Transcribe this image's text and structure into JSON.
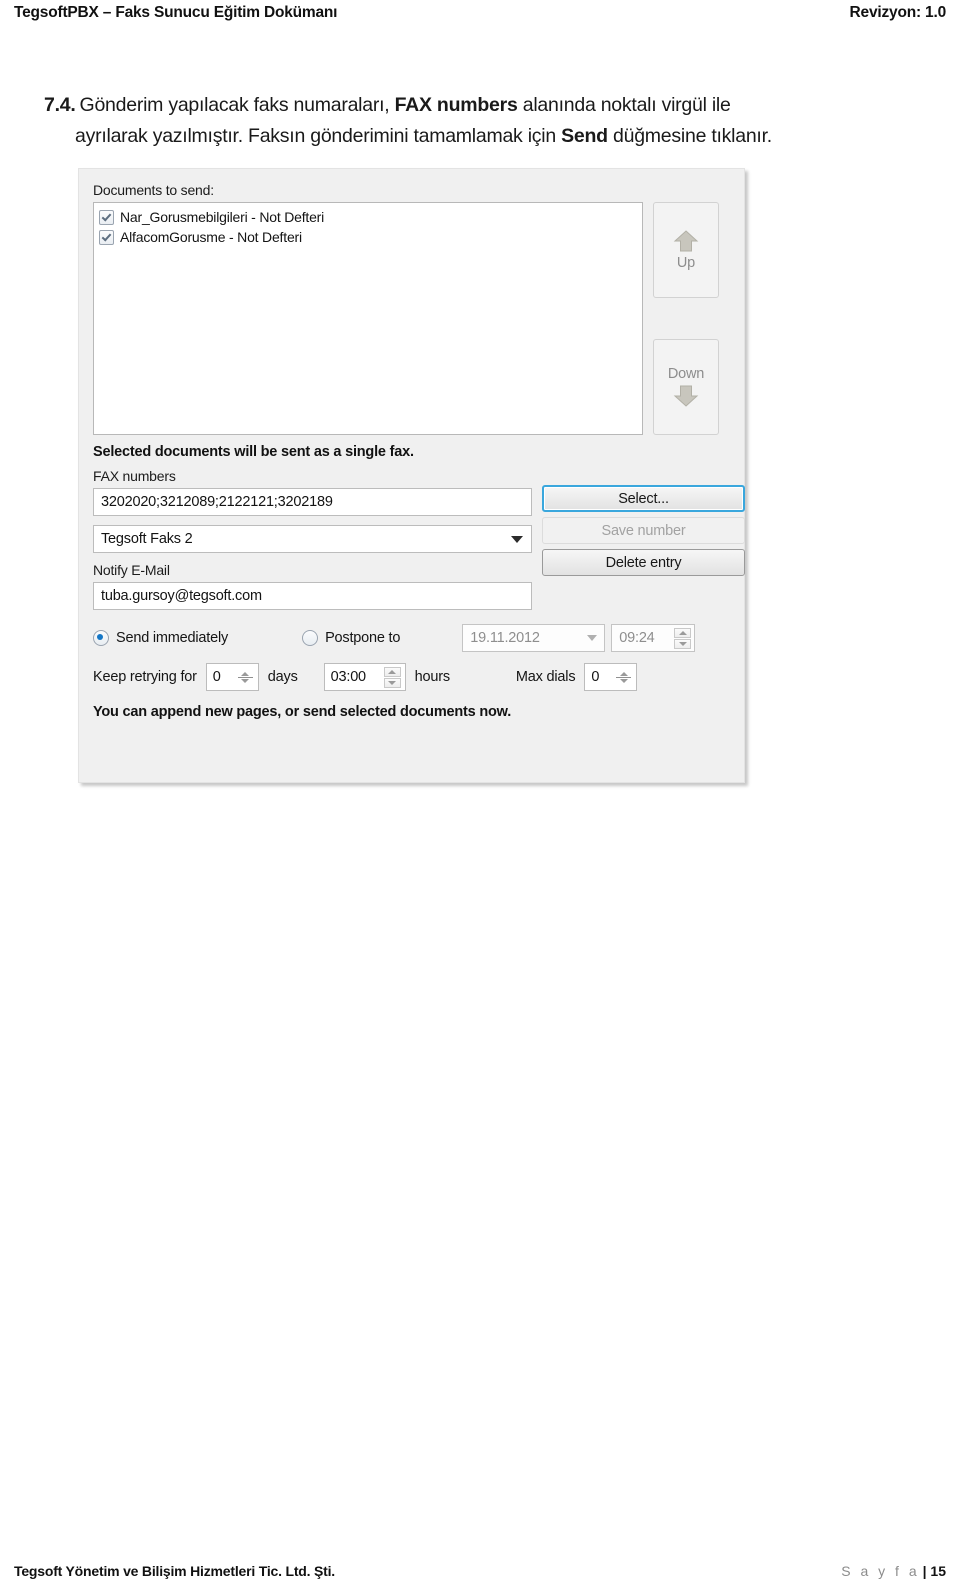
{
  "header": {
    "left_title": "TegsoftPBX – Faks Sunucu Eğitim Dokümanı",
    "right_revision": "Revizyon: 1.0"
  },
  "paragraph": {
    "number": "7.4.",
    "line1_a": "Gönderim yapılacak faks numaraları,",
    "line1_bold": "FAX numbers",
    "line1_b": "alanında noktalı virgül ile",
    "line2_a": "ayrılarak yazılmıştır. Faksın gönderimini tamamlamak için",
    "line2_bold": "Send",
    "line2_b": "düğmesine tıklanır."
  },
  "dialog": {
    "documents_label": "Documents to send:",
    "documents": [
      {
        "label": "Nar_Gorusmebilgileri - Not Defteri",
        "checked": true
      },
      {
        "label": "AlfacomGorusme - Not Defteri",
        "checked": true
      }
    ],
    "up_button": "Up",
    "down_button": "Down",
    "single_fax_note": "Selected documents will be sent as a single fax.",
    "fax_numbers_label": "FAX numbers",
    "fax_numbers_value": "3202020;3212089;2122121;3202189",
    "fax_profile_selected": "Tegsoft Faks 2",
    "notify_email_label": "Notify E-Mail",
    "notify_email_value": "tuba.gursoy@tegsoft.com",
    "buttons": {
      "select": "Select...",
      "save_number": "Save number",
      "delete_entry": "Delete entry"
    },
    "schedule": {
      "send_immediately": "Send immediately",
      "postpone_to": "Postpone to",
      "date_value": "19.11.2012",
      "time_value": "09:24"
    },
    "retry": {
      "keep_retrying_label": "Keep retrying for",
      "days_value": "0",
      "days_label": "days",
      "hours_value": "03:00",
      "hours_label": "hours",
      "max_dials_label": "Max dials",
      "max_dials_value": "0"
    },
    "bottom_note": "You can append new pages, or send selected documents now.",
    "accent_focus_color": "#3aa7dd",
    "radio_selected_color": "#1577c6"
  },
  "footer": {
    "company": "Tegsoft Yönetim ve Bilişim Hizmetleri Tic. Ltd. Şti.",
    "page_word": "S a y f a",
    "page_number": "| 15"
  }
}
